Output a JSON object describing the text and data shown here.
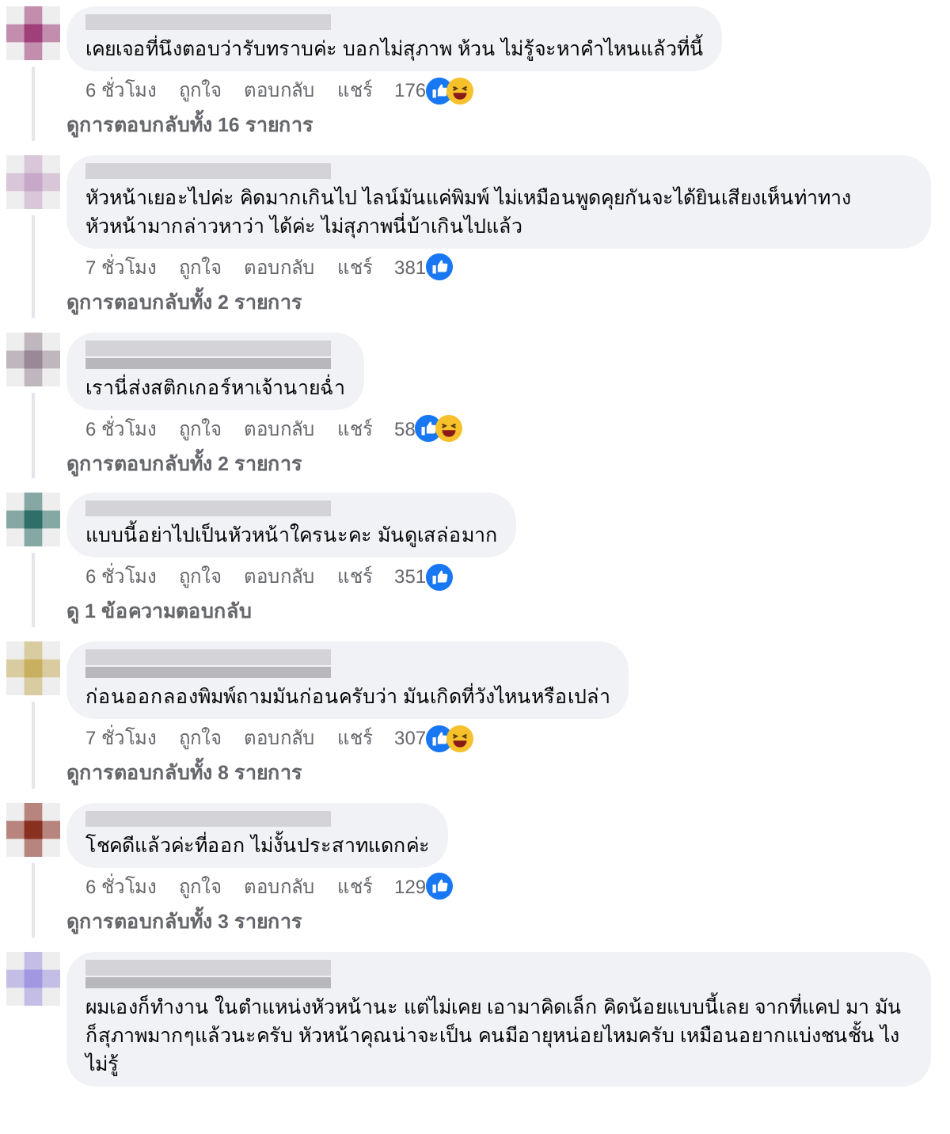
{
  "comments": [
    {
      "text": "เคยเจอที่นึงตอบว่ารับทราบค่ะ บอกไม่สุภาพ ห้วน ไม่รู้จะหาคำไหนแล้วที่นี้",
      "time": "6 ชั่วโมง",
      "like": "ถูกใจ",
      "reply": "ตอบกลับ",
      "share": "แชร์",
      "count": "176",
      "haha_reaction": true,
      "view_replies": "ดูการตอบกลับทั้ง 16 รายการ"
    },
    {
      "text": "หัวหน้าเยอะไปค่ะ คิดมากเกินไป ไลน์มันแค่พิมพ์ ไม่เหมือนพูดคุยกันจะได้ยินเสียงเห็นท่าทาง หัวหน้ามากล่าวหาว่า ได้ค่ะ ไม่สุภาพนี่บ้าเกินไปแล้ว",
      "time": "7 ชั่วโมง",
      "like": "ถูกใจ",
      "reply": "ตอบกลับ",
      "share": "แชร์",
      "count": "381",
      "haha_reaction": false,
      "view_replies": "ดูการตอบกลับทั้ง 2 รายการ"
    },
    {
      "text": "เรานี่ส่งสติกเกอร์หาเจ้านายฉ่ำ",
      "time": "6 ชั่วโมง",
      "like": "ถูกใจ",
      "reply": "ตอบกลับ",
      "share": "แชร์",
      "count": "58",
      "haha_reaction": true,
      "view_replies": "ดูการตอบกลับทั้ง 2 รายการ"
    },
    {
      "text": "แบบนี้อย่าไปเป็นหัวหน้าใครนะคะ มันดูเสล่อมาก",
      "time": "6 ชั่วโมง",
      "like": "ถูกใจ",
      "reply": "ตอบกลับ",
      "share": "แชร์",
      "count": "351",
      "haha_reaction": false,
      "view_replies": "ดู 1 ข้อความตอบกลับ"
    },
    {
      "text": "ก่อนออกลองพิมพ์ถามมันก่อนครับว่า มันเกิดที่วังไหนหรือเปล่า",
      "time": "7 ชั่วโมง",
      "like": "ถูกใจ",
      "reply": "ตอบกลับ",
      "share": "แชร์",
      "count": "307",
      "haha_reaction": true,
      "view_replies": "ดูการตอบกลับทั้ง 8 รายการ"
    },
    {
      "text": "โชคดีแล้วค่ะที่ออก ไม่งั้นประสาทแดกค่ะ",
      "time": "6 ชั่วโมง",
      "like": "ถูกใจ",
      "reply": "ตอบกลับ",
      "share": "แชร์",
      "count": "129",
      "haha_reaction": false,
      "view_replies": "ดูการตอบกลับทั้ง 3 รายการ"
    },
    {
      "text": "ผมเองก็ทำงาน ในตำแหน่งหัวหน้านะ แต่ไม่เคย เอามาคิดเล็ก คิดน้อยแบบนี้เลย จากที่แคป มา มันก็สุภาพมากๆแล้วนะครับ หัวหน้าคุณน่าจะเป็น คนมีอายุหน่อยไหมครับ เหมือนอยากแบ่งชนชั้น ไงไม่รู้"
    }
  ]
}
